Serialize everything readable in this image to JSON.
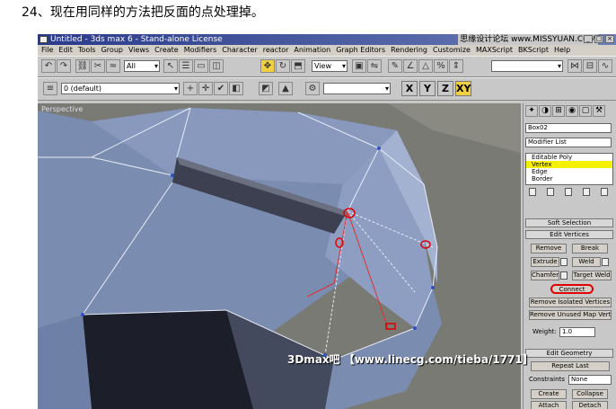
{
  "caption": "24、现在用同样的方法把反面的点处理掉。",
  "window": {
    "title": "Untitled - 3ds max 6 - Stand-alone License",
    "watermark_top": "思缘设计论坛 www.MISSYUAN.COM"
  },
  "menu": [
    "File",
    "Edit",
    "Tools",
    "Group",
    "Views",
    "Create",
    "Modifiers",
    "Character",
    "reactor",
    "Animation",
    "Graph Editors",
    "Rendering",
    "Customize",
    "MAXScript",
    "BKScript",
    "Help"
  ],
  "toolbar": {
    "selection_filter": "All",
    "ref_coord": "View",
    "layer": "0 (default)",
    "axis_x": "X",
    "axis_y": "Y",
    "axis_z": "Z",
    "axis_xy": "XY"
  },
  "viewport": {
    "label": "Perspective"
  },
  "command_panel": {
    "object_name": "Box02",
    "modifier_list": "Modifier List",
    "stack": [
      "Editable Poly",
      "Vertex",
      "Edge",
      "Border"
    ],
    "rollout_soft_selection": "Soft Selection",
    "rollout_edit_vertices": "Edit Vertices",
    "remove_label": "Remove",
    "break_label": "Break",
    "extrude_label": "Extrude",
    "weld_label": "Weld",
    "chamfer_label": "Chamfer",
    "target_weld_label": "Target Weld",
    "connect_label": "Connect",
    "remove_isolated_label": "Remove Isolated Vertices",
    "remove_unused_map_label": "Remove Unused Map Verts",
    "weight_label": "Weight:",
    "weight_value": "1.0",
    "rollout_edit_geometry": "Edit Geometry",
    "repeat_last_label": "Repeat Last",
    "constraints_label": "Constraints",
    "constraints_value": "None",
    "bottom_buttons": [
      "Create",
      "Collapse",
      "Attach",
      "Detach"
    ]
  },
  "footer_watermark": "3Dmax吧 【www.linecg.com/tieba/1771】"
}
